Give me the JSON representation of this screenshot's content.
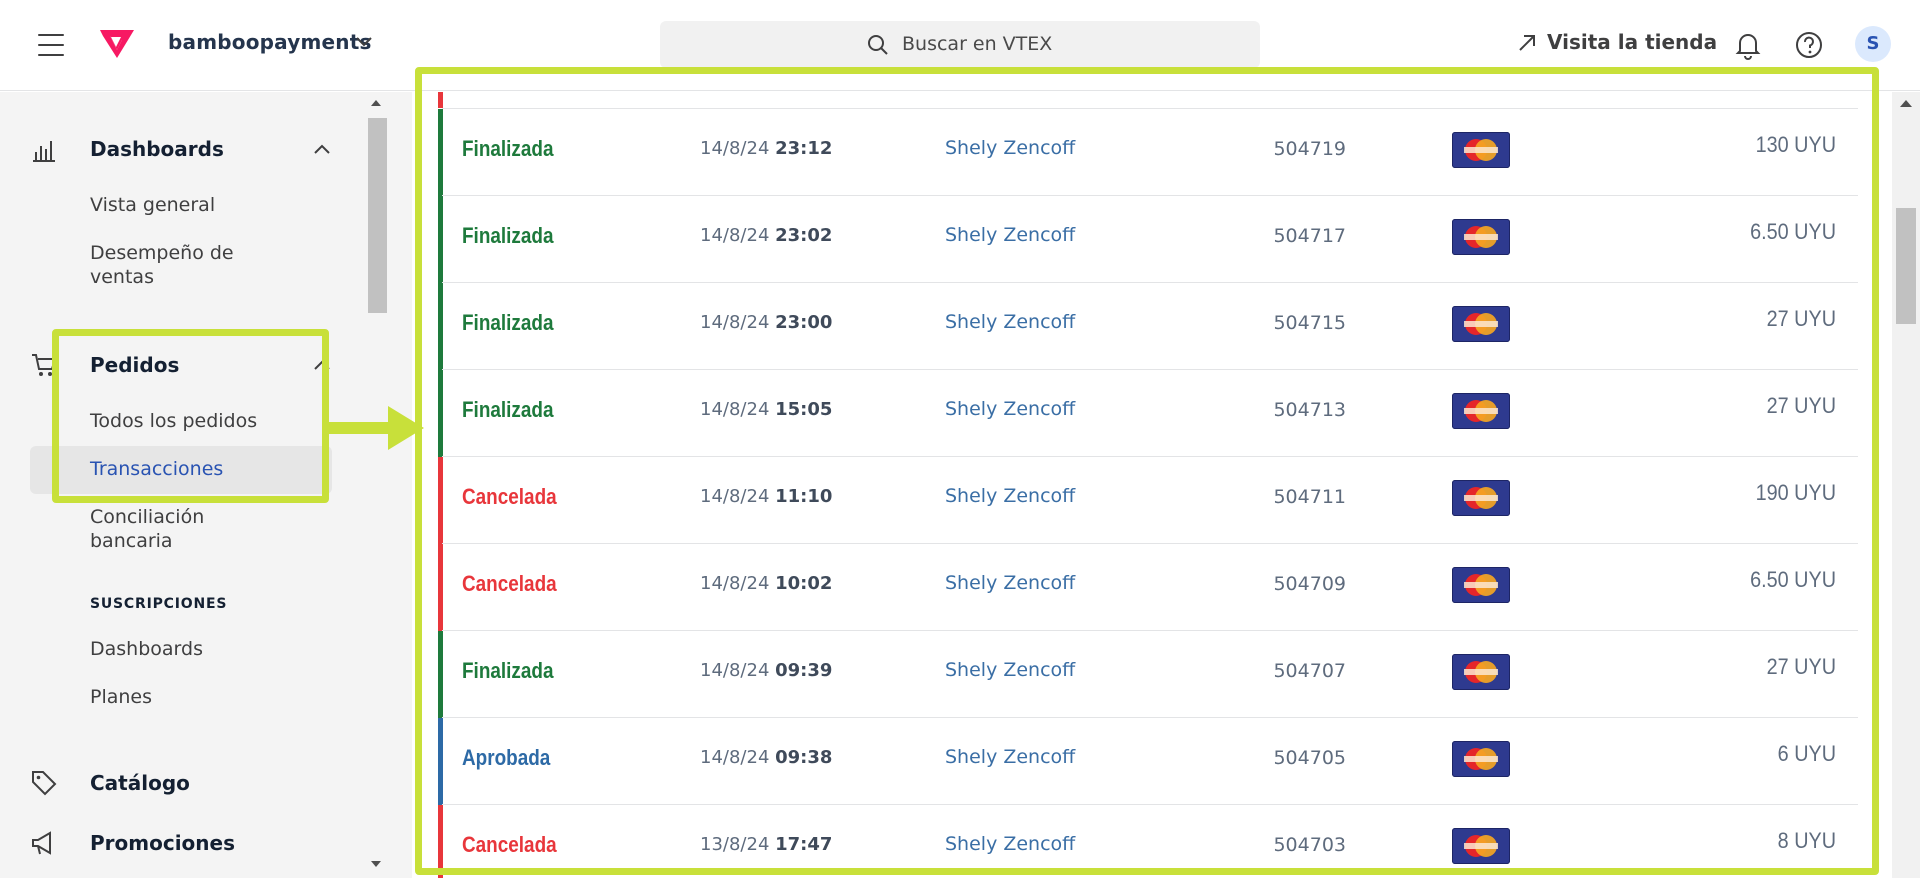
{
  "topbar": {
    "account": "bamboopayments",
    "search_placeholder": "Buscar en VTEX",
    "visit_store": "Visita la tienda",
    "avatar_initial": "S"
  },
  "sidebar": {
    "dashboards": {
      "title": "Dashboards",
      "items": [
        "Vista general",
        "Desempeño de",
        "ventas"
      ]
    },
    "pedidos": {
      "title": "Pedidos",
      "items": [
        "Todos los pedidos",
        "Transacciones",
        "Conciliación",
        "bancaria"
      ]
    },
    "suscripciones": {
      "caption": "SUSCRIPCIONES",
      "items": [
        "Dashboards",
        "Planes"
      ]
    },
    "catalogo": "Catálogo",
    "promociones": "Promociones"
  },
  "colors": {
    "finalizada": "#1e7a3c",
    "cancelada": "#e8363b",
    "aprobada": "#2d6aa6",
    "highlight": "#c8e03a",
    "brand": "#f71963"
  },
  "transactions": [
    {
      "status": "Finalizada",
      "status_type": "finalizada",
      "date": "14/8/24",
      "time": "23:12",
      "client": "Shely Zencoff",
      "order": "504719",
      "card": "mastercard-icon",
      "amount": "130 UYU"
    },
    {
      "status": "Finalizada",
      "status_type": "finalizada",
      "date": "14/8/24",
      "time": "23:02",
      "client": "Shely Zencoff",
      "order": "504717",
      "card": "mastercard-icon",
      "amount": "6.50 UYU"
    },
    {
      "status": "Finalizada",
      "status_type": "finalizada",
      "date": "14/8/24",
      "time": "23:00",
      "client": "Shely Zencoff",
      "order": "504715",
      "card": "mastercard-icon",
      "amount": "27 UYU"
    },
    {
      "status": "Finalizada",
      "status_type": "finalizada",
      "date": "14/8/24",
      "time": "15:05",
      "client": "Shely Zencoff",
      "order": "504713",
      "card": "mastercard-icon",
      "amount": "27 UYU"
    },
    {
      "status": "Cancelada",
      "status_type": "cancelada",
      "date": "14/8/24",
      "time": "11:10",
      "client": "Shely Zencoff",
      "order": "504711",
      "card": "mastercard-icon",
      "amount": "190 UYU"
    },
    {
      "status": "Cancelada",
      "status_type": "cancelada",
      "date": "14/8/24",
      "time": "10:02",
      "client": "Shely Zencoff",
      "order": "504709",
      "card": "mastercard-icon",
      "amount": "6.50 UYU"
    },
    {
      "status": "Finalizada",
      "status_type": "finalizada",
      "date": "14/8/24",
      "time": "09:39",
      "client": "Shely Zencoff",
      "order": "504707",
      "card": "mastercard-icon",
      "amount": "27 UYU"
    },
    {
      "status": "Aprobada",
      "status_type": "aprobada",
      "date": "14/8/24",
      "time": "09:38",
      "client": "Shely Zencoff",
      "order": "504705",
      "card": "mastercard-icon",
      "amount": "6 UYU"
    },
    {
      "status": "Cancelada",
      "status_type": "cancelada",
      "date": "13/8/24",
      "time": "17:47",
      "client": "Shely Zencoff",
      "order": "504703",
      "card": "mastercard-icon",
      "amount": "8 UYU"
    }
  ]
}
